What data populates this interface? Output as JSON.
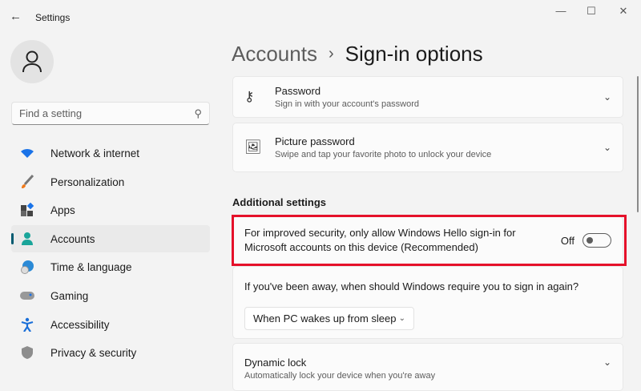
{
  "window": {
    "title": "Settings",
    "back": "←",
    "minimize": "—",
    "maximize": "☐",
    "close": "✕"
  },
  "search": {
    "placeholder": "Find a setting"
  },
  "nav": [
    {
      "label": "Network & internet",
      "icon": "wifi-icon"
    },
    {
      "label": "Personalization",
      "icon": "brush-icon"
    },
    {
      "label": "Apps",
      "icon": "apps-icon"
    },
    {
      "label": "Accounts",
      "icon": "person-icon",
      "selected": true
    },
    {
      "label": "Time & language",
      "icon": "globe-clock-icon"
    },
    {
      "label": "Gaming",
      "icon": "gamepad-icon"
    },
    {
      "label": "Accessibility",
      "icon": "accessibility-icon"
    },
    {
      "label": "Privacy & security",
      "icon": "shield-icon"
    }
  ],
  "header": {
    "parent": "Accounts",
    "separator": "›",
    "title": "Sign-in options"
  },
  "cards": {
    "password": {
      "title": "Password",
      "desc": "Sign in with your account's password"
    },
    "picture": {
      "title": "Picture password",
      "desc": "Swipe and tap your favorite photo to unlock your device"
    }
  },
  "additional": {
    "heading": "Additional settings",
    "hello_only": {
      "line1": "For improved security, only allow Windows Hello sign-in for",
      "line2": "Microsoft accounts on this device (Recommended)",
      "state": "Off"
    },
    "away": {
      "question": "If you've been away, when should Windows require you to sign in again?",
      "selected": "When PC wakes up from sleep"
    },
    "dynamic_lock": {
      "title": "Dynamic lock",
      "desc": "Automatically lock your device when you're away"
    }
  },
  "colors": {
    "accent": "#005a70",
    "highlight": "#e5112a"
  }
}
